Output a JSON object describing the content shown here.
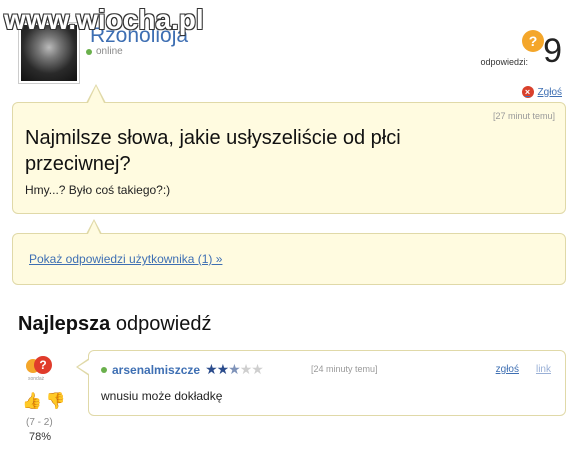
{
  "watermark": {
    "text": "www.wiocha.pl"
  },
  "question": {
    "author": {
      "name": "Rzonolioja",
      "status": "online"
    },
    "answers_label": "odpowiedzi:",
    "answers_count": "9",
    "report_label": "Zgłoś",
    "time": "[27 minut temu]",
    "title": "Najmilsze słowa, jakie usłyszeliście od płci przeciwnej?",
    "body": "Hmy...? Było coś takiego?:)",
    "show_user_answers": "Pokaż odpowiedzi użytkownika (1) »"
  },
  "best_answer": {
    "heading_bold": "Najlepsza",
    "heading_rest": " odpowiedź",
    "badge_label": "sondaż",
    "votes": {
      "counts": "(7 - 2)",
      "percent": "78%"
    },
    "user": "arsenalmiszcze",
    "rating": {
      "filled": 2.5,
      "total": 5
    },
    "time": "[24 minuty temu]",
    "report_label": "zgłoś",
    "link_label": "link",
    "text": "wnusiu może dokładkę"
  },
  "colors": {
    "link": "#3e6fb3",
    "question_bg": "#fffbe0",
    "border": "#e0d9a8",
    "accent_orange": "#f4a62a"
  }
}
